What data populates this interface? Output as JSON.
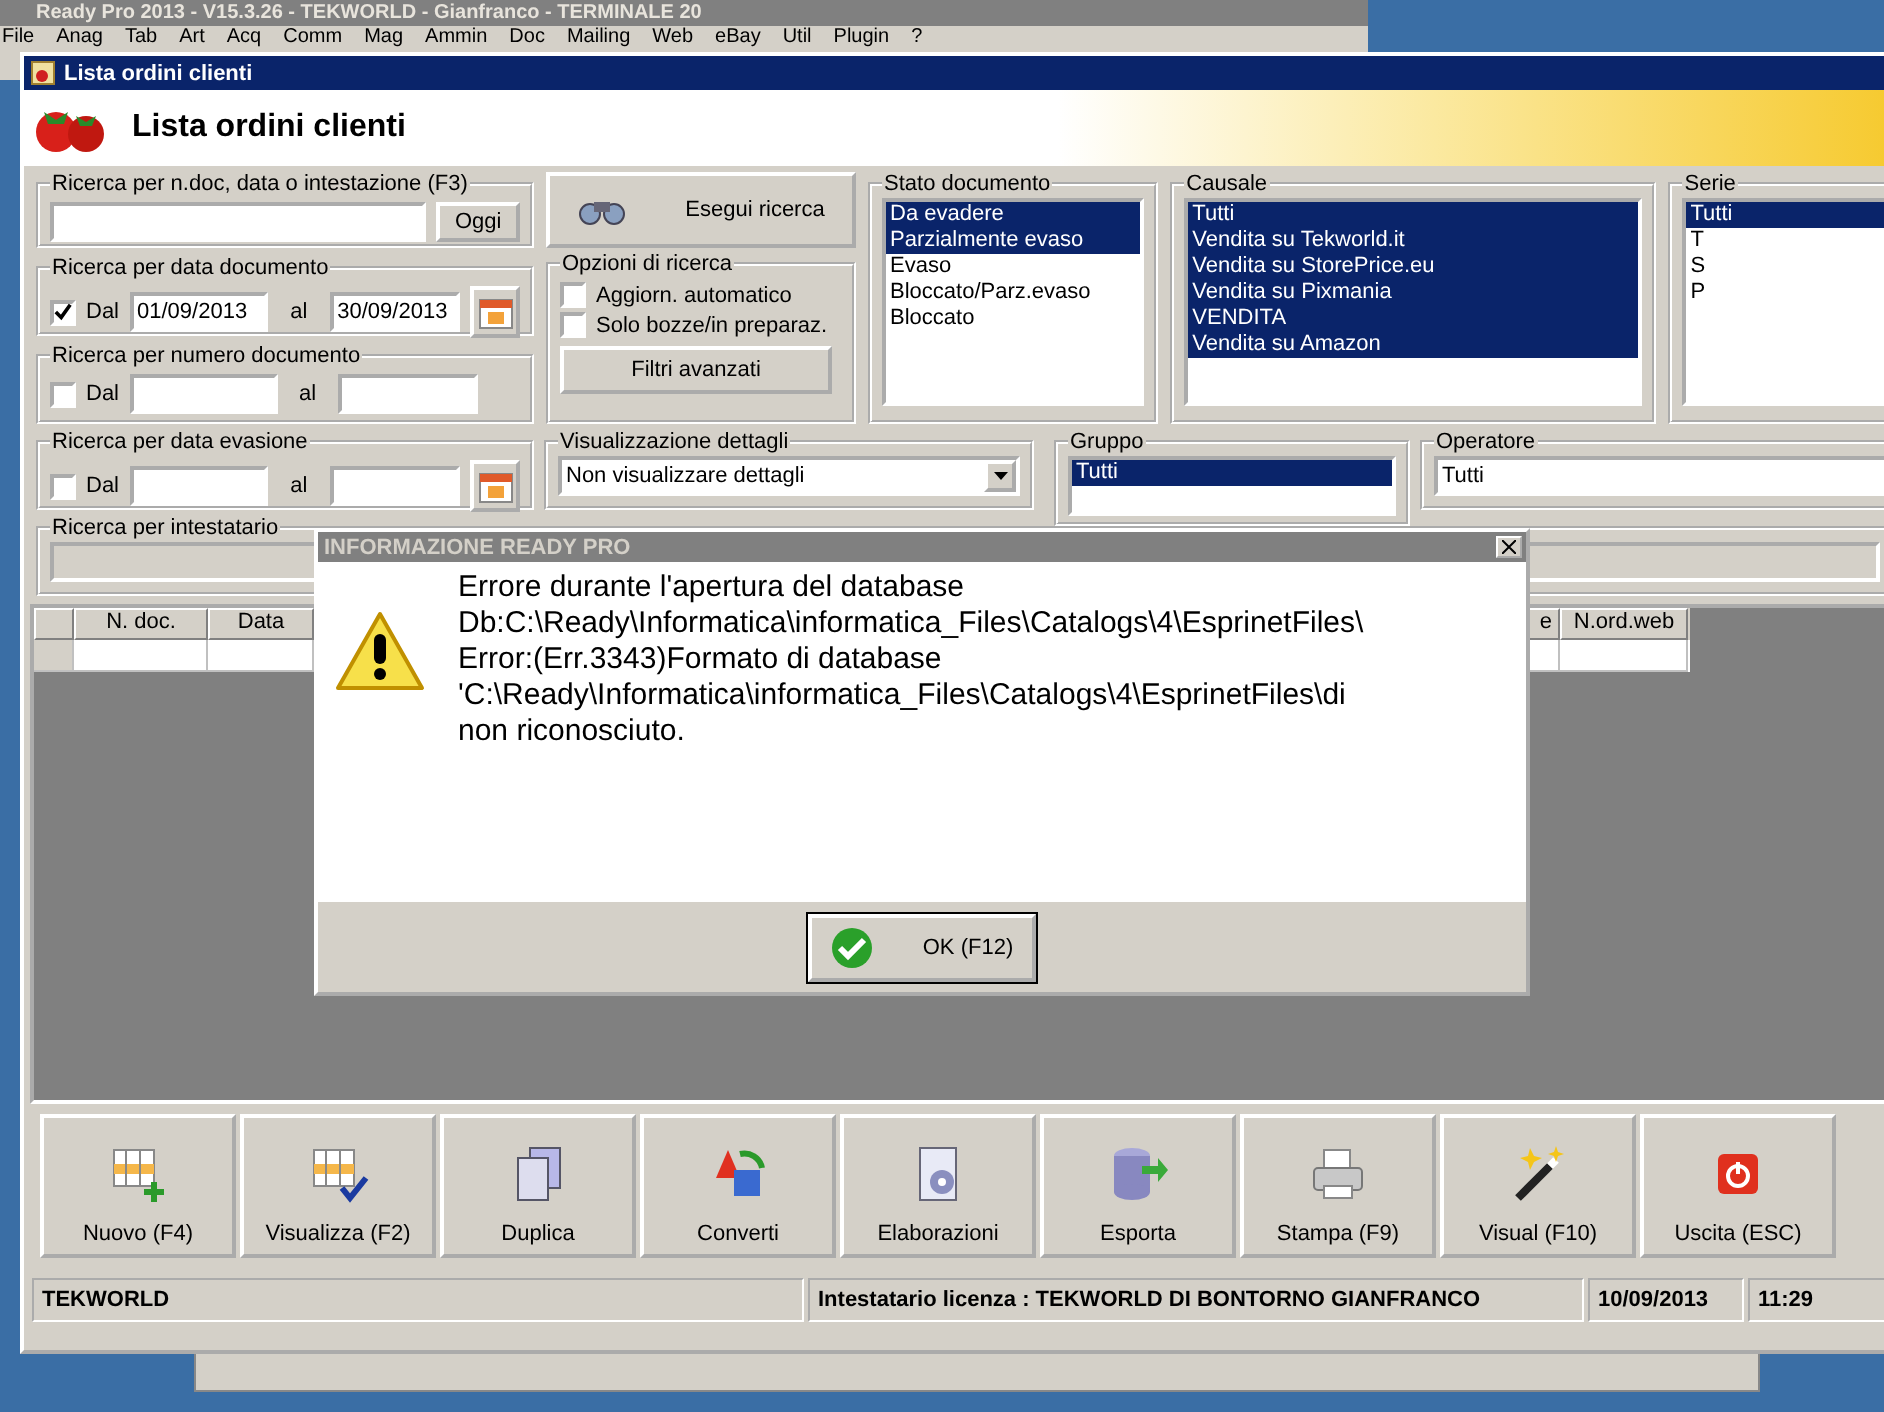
{
  "back_window": {
    "title": "Ready Pro 2013 - V15.3.26 - TEKWORLD - Gianfranco - TERMINALE 20",
    "menu": [
      "File",
      "Anag",
      "Tab",
      "Art",
      "Acq",
      "Comm",
      "Mag",
      "Ammin",
      "Doc",
      "Mailing",
      "Web",
      "eBay",
      "Util",
      "Plugin",
      "?"
    ]
  },
  "window": {
    "title": "Lista ordini clienti",
    "heading": "Lista ordini clienti"
  },
  "search": {
    "label": "Ricerca per n.doc, data o intestazione (F3)",
    "button": "Oggi"
  },
  "run_button": "Esegui ricerca",
  "range_filters": [
    {
      "kind": "date",
      "label": "Ricerca per data documento",
      "checkbox_label": "Dal",
      "checked": true,
      "from": "01/09/2013",
      "to_label": "al",
      "to": "30/09/2013"
    },
    {
      "kind": "number",
      "label": "Ricerca per numero documento",
      "checkbox_label": "Dal",
      "checked": false,
      "to_label": "al"
    },
    {
      "kind": "date",
      "label": "Ricerca per data evasione",
      "checkbox_label": "Dal",
      "checked": false,
      "to_label": "al"
    }
  ],
  "options": {
    "title": "Opzioni di ricerca",
    "items": [
      {
        "label": "Aggiorn. automatico",
        "checked": false
      },
      {
        "label": "Solo bozze/in preparaz.",
        "checked": false
      }
    ],
    "button": "Filtri avanzati"
  },
  "lists": [
    {
      "title": "Stato documento",
      "items": [
        {
          "label": "Da evadere",
          "selected": true
        },
        {
          "label": "Parzialmente evaso",
          "selected": true
        },
        {
          "label": "Evaso",
          "selected": false
        },
        {
          "label": "Bloccato/Parz.evaso",
          "selected": false
        },
        {
          "label": "Bloccato",
          "selected": false
        }
      ]
    },
    {
      "title": "Causale",
      "items": [
        {
          "label": "Tutti",
          "selected": true
        },
        {
          "label": "Vendita su Tekworld.it",
          "selected": true
        },
        {
          "label": "Vendita su StorePrice.eu",
          "selected": true
        },
        {
          "label": "Vendita su Pixmania",
          "selected": true
        },
        {
          "label": "VENDITA",
          "selected": true
        },
        {
          "label": "Vendita su Amazon",
          "selected": true
        }
      ]
    },
    {
      "title": "Serie",
      "items": [
        {
          "label": "Tutti",
          "selected": true
        },
        {
          "label": "T",
          "selected": false
        },
        {
          "label": "S",
          "selected": false
        },
        {
          "label": "P",
          "selected": false
        }
      ]
    }
  ],
  "details": {
    "title": "Visualizzazione dettagli",
    "value": "Non visualizzare dettagli"
  },
  "group": {
    "title": "Gruppo",
    "items": [
      {
        "label": "Tutti",
        "selected": true
      }
    ]
  },
  "operator": {
    "title": "Operatore",
    "value": "Tutti"
  },
  "holder": {
    "title": "Ricerca per intestatario"
  },
  "table": {
    "columns": [
      "N. doc.",
      "Data",
      "e",
      "N.ord.web"
    ]
  },
  "toolbar": [
    {
      "kind": "new",
      "label": "Nuovo (F4)"
    },
    {
      "kind": "view",
      "label": "Visualizza (F2)"
    },
    {
      "kind": "copy",
      "label": "Duplica"
    },
    {
      "kind": "convert",
      "label": "Converti"
    },
    {
      "kind": "process",
      "label": "Elaborazioni"
    },
    {
      "kind": "export",
      "label": "Esporta"
    },
    {
      "kind": "print",
      "label": "Stampa (F9)"
    },
    {
      "kind": "wand",
      "label": "Visual (F10)"
    },
    {
      "kind": "exit",
      "label": "Uscita (ESC)"
    }
  ],
  "status_bar": [
    "TEKWORLD",
    "Intestatario licenza : TEKWORLD DI BONTORNO GIANFRANCO",
    "10/09/2013",
    "11:29"
  ],
  "dialog": {
    "title": "INFORMAZIONE READY PRO",
    "lines": [
      "Errore durante l'apertura del database",
      "Db:C:\\Ready\\Informatica\\informatica_Files\\Catalogs\\4\\EsprinetFiles\\",
      "Error:(Err.3343)Formato di database",
      "'C:\\Ready\\Informatica\\informatica_Files\\Catalogs\\4\\EsprinetFiles\\di",
      "non riconosciuto."
    ],
    "button": "OK (F12)"
  }
}
